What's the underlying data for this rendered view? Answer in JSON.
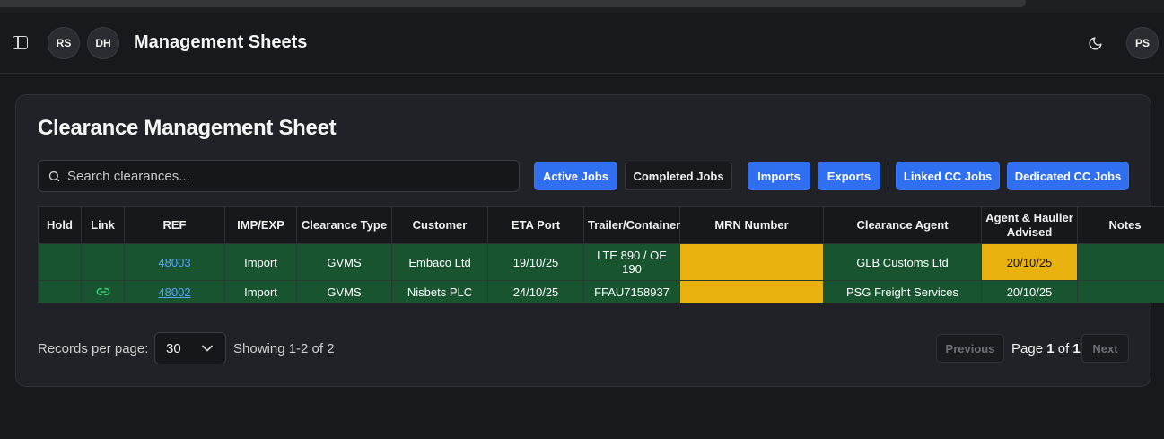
{
  "header": {
    "title": "Management Sheets",
    "avatars": [
      "RS",
      "DH"
    ],
    "user_avatar": "PS",
    "icons": [
      "sidebar-toggle-icon",
      "moon-icon"
    ]
  },
  "card": {
    "title": "Clearance Management Sheet",
    "search_placeholder": "Search clearances...",
    "filters": {
      "active_jobs": "Active Jobs",
      "completed_jobs": "Completed Jobs",
      "imports": "Imports",
      "exports": "Exports",
      "linked_cc_jobs": "Linked CC Jobs",
      "dedicated_cc_jobs": "Dedicated CC Jobs"
    }
  },
  "table": {
    "headers": [
      "Hold",
      "Link",
      "REF",
      "IMP/EXP",
      "Clearance Type",
      "Customer",
      "ETA Port",
      "Trailer/Container",
      "MRN Number",
      "Clearance Agent",
      "Agent & Haulier Advised",
      "Notes"
    ],
    "rows": [
      {
        "hold": "",
        "link": "",
        "ref": "48003",
        "imp_exp": "Import",
        "clearance_type": "GVMS",
        "customer": "Embaco Ltd",
        "eta_port": "19/10/25",
        "trailer": "LTE 890 / OE 190",
        "mrn": "",
        "agent": "GLB Customs Ltd",
        "advised": "20/10/25",
        "notes": ""
      },
      {
        "hold": "",
        "link": "link-icon",
        "ref": "48002",
        "imp_exp": "Import",
        "clearance_type": "GVMS",
        "customer": "Nisbets PLC",
        "eta_port": "24/10/25",
        "trailer": "FFAU7158937",
        "mrn": "",
        "agent": "PSG Freight Services",
        "advised": "20/10/25",
        "notes": ""
      }
    ],
    "colors": {
      "row_green": "#17542f",
      "amber": "#e8b10d",
      "link": "#5aa2ff"
    }
  },
  "pagination": {
    "records_label": "Records per page:",
    "per_page_value": "30",
    "showing": "Showing 1-2 of 2",
    "previous": "Previous",
    "page_prefix": "Page",
    "page_current": "1",
    "page_of": "of",
    "page_total": "1",
    "next": "Next"
  },
  "colors": {
    "accent": "#2f6ff0",
    "background": "#18191d",
    "card": "#202227"
  }
}
